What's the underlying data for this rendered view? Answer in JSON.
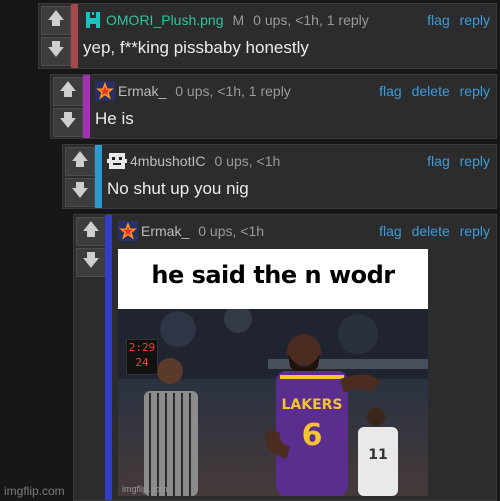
{
  "comments": [
    {
      "username": "OMORI_Plush.png",
      "tag": "M",
      "meta": "0 ups, <1h, 1 reply",
      "actions": [
        "flag",
        "reply"
      ],
      "text": "yep, f**king pissbaby honestly",
      "avatar_icon": "green-pixel-icon"
    },
    {
      "username": "Ermak_",
      "meta": "0 ups, <1h, 1 reply",
      "actions": [
        "flag",
        "delete",
        "reply"
      ],
      "text": "He is",
      "avatar_icon": "colorful-star-icon"
    },
    {
      "username": "4mbushotIC",
      "meta": "0 ups, <1h",
      "actions": [
        "flag",
        "reply"
      ],
      "text": "No shut up you nig",
      "avatar_icon": "pixel-face-icon"
    },
    {
      "username": "Ermak_",
      "meta": "0 ups, <1h",
      "actions": [
        "flag",
        "delete",
        "reply"
      ],
      "avatar_icon": "colorful-star-icon",
      "image": {
        "caption": "he said the n wodr",
        "shot_clock_top": "2:29",
        "shot_clock_bottom": "24",
        "jersey_team": "LAKERS",
        "jersey_number": "6",
        "watermark": "imgflip.com"
      }
    }
  ],
  "vote_up_icon": "arrow-up-icon",
  "vote_down_icon": "arrow-down-icon",
  "site_watermark": "imgflip.com",
  "colors": {
    "background": "#171717",
    "panel": "#2c2c2c",
    "link": "#3e9bdb",
    "stripe_1": "#a44a4a",
    "stripe_2": "#a132b2",
    "stripe_3": "#2f9ad1",
    "stripe_4": "#2f3fc9"
  }
}
